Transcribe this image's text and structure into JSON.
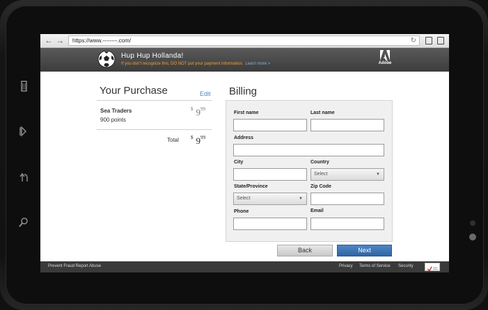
{
  "browser": {
    "url": "https://www.--------.com/",
    "back_glyph": "←",
    "forward_glyph": "→",
    "reload_glyph": "↻"
  },
  "banner": {
    "merchant_name": "Hup Hup Hollanda!",
    "warning": "If you don't recognize this, DO NOT put your payment information.",
    "learn_more": "Learn more >",
    "brand": "Adobe"
  },
  "purchase": {
    "title": "Your Purchase",
    "edit": "Edit",
    "item": {
      "name": "Sea Traders",
      "points": "900 points",
      "currency": "$",
      "dollars": "9",
      "cents": "99"
    },
    "total": {
      "label": "Total",
      "currency": "$",
      "dollars": "9",
      "cents": "99"
    }
  },
  "billing": {
    "title": "Billing",
    "first_name": {
      "label": "First name",
      "value": ""
    },
    "last_name": {
      "label": "Last name",
      "value": ""
    },
    "address": {
      "label": "Address",
      "value": ""
    },
    "city": {
      "label": "City",
      "value": ""
    },
    "country": {
      "label": "Country",
      "selected": "Select"
    },
    "state": {
      "label": "State/Province",
      "selected": "Select"
    },
    "zip": {
      "label": "Zip Code",
      "value": ""
    },
    "phone": {
      "label": "Phone",
      "value": ""
    },
    "email": {
      "label": "Email",
      "value": ""
    },
    "back": "Back",
    "next": "Next"
  },
  "footer": {
    "report": "Prevent Fraud Report Abuse",
    "privacy": "Privacy",
    "terms": "Terms of Service",
    "security": "Security"
  },
  "colors": {
    "accent": "#3a6fb0",
    "warning": "#f0a030",
    "link": "#4a86c5"
  }
}
